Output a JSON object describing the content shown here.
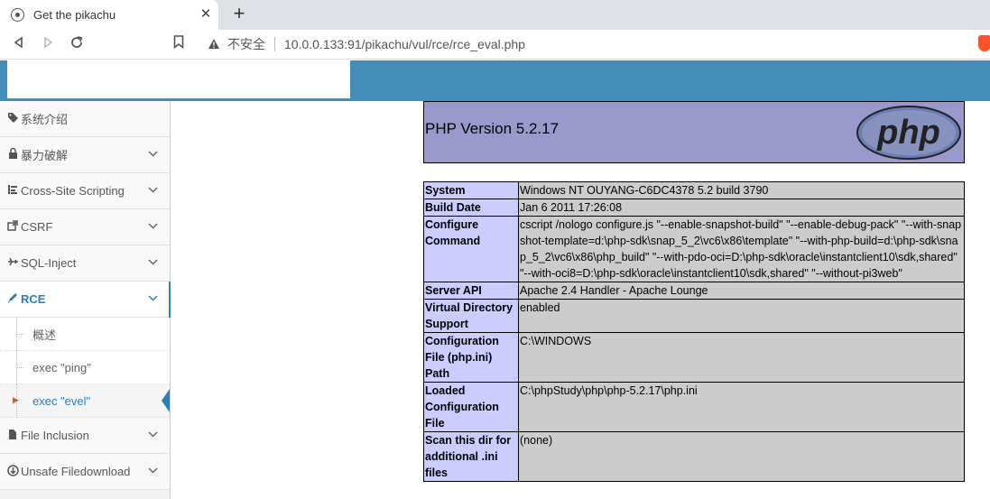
{
  "browser": {
    "tab_title": "Get the pikachu",
    "tab_close": "✕",
    "new_tab": "+",
    "security_label": "不安全",
    "url": "10.0.0.133:91/pikachu/vul/rce/rce_eval.php"
  },
  "sidebar": {
    "items": [
      {
        "label": "系统介绍",
        "icon": "tag-icon"
      },
      {
        "label": "暴力破解",
        "icon": "lock-icon"
      },
      {
        "label": "Cross-Site Scripting",
        "icon": "code-icon"
      },
      {
        "label": "CSRF",
        "icon": "share-icon"
      },
      {
        "label": "SQL-Inject",
        "icon": "plane-icon"
      },
      {
        "label": "RCE",
        "icon": "pencil-icon"
      },
      {
        "label": "File Inclusion",
        "icon": "file-icon"
      },
      {
        "label": "Unsafe Filedownload",
        "icon": "download-icon"
      }
    ],
    "rce_sub": [
      {
        "label": "概述"
      },
      {
        "label": "exec \"ping\""
      },
      {
        "label": "exec \"evel\""
      }
    ]
  },
  "phpinfo": {
    "version": "PHP Version 5.2.17",
    "logo_text": "php",
    "rows": [
      {
        "key": "System",
        "value": "Windows NT OUYANG-C6DC4378 5.2 build 3790"
      },
      {
        "key": "Build Date",
        "value": "Jan 6 2011 17:26:08"
      },
      {
        "key": "Configure Command",
        "value": "cscript /nologo configure.js \"--enable-snapshot-build\" \"--enable-debug-pack\" \"--with-snapshot-template=d:\\php-sdk\\snap_5_2\\vc6\\x86\\template\" \"--with-php-build=d:\\php-sdk\\snap_5_2\\vc6\\x86\\php_build\" \"--with-pdo-oci=D:\\php-sdk\\oracle\\instantclient10\\sdk,shared\" \"--with-oci8=D:\\php-sdk\\oracle\\instantclient10\\sdk,shared\" \"--without-pi3web\""
      },
      {
        "key": "Server API",
        "value": "Apache 2.4 Handler - Apache Lounge"
      },
      {
        "key": "Virtual Directory Support",
        "value": "enabled"
      },
      {
        "key": "Configuration File (php.ini) Path",
        "value": "C:\\WINDOWS"
      },
      {
        "key": "Loaded Configuration File",
        "value": "C:\\phpStudy\\php\\php-5.2.17\\php.ini"
      },
      {
        "key": "Scan this dir for additional .ini files",
        "value": "(none)"
      }
    ]
  },
  "colors": {
    "header_blue": "#438eb9",
    "active_blue": "#2b7dbc",
    "php_header": "#9999cc",
    "php_key": "#ccccff",
    "php_value": "#cccccc"
  }
}
